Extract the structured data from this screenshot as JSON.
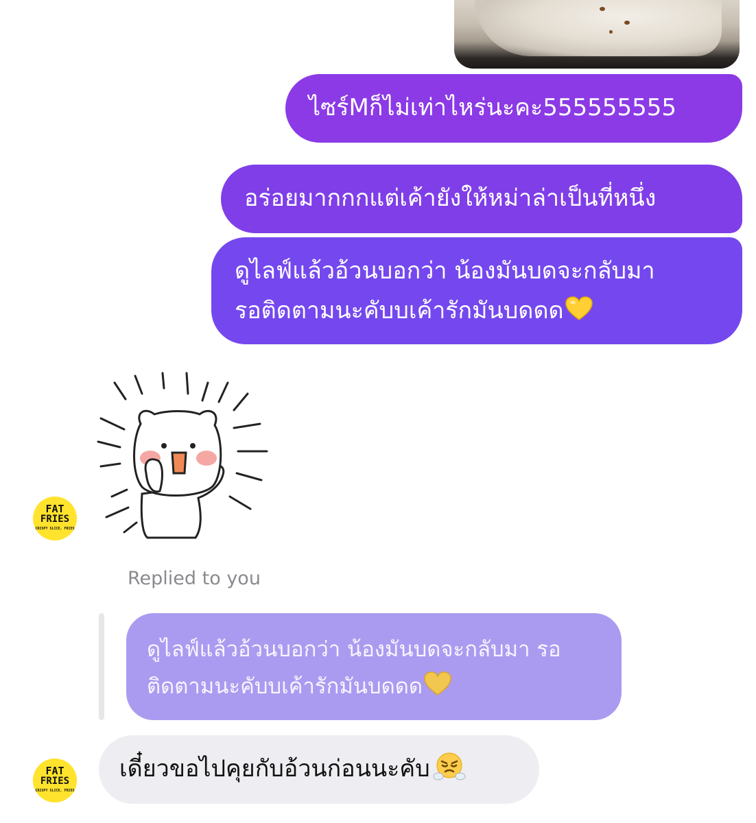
{
  "messages": {
    "outgoing_1": "ไซร์Mก็ไม่เท่าไหร่นะคะ555555555",
    "outgoing_2": "อร่อยมากกกแต่เค้ายังให้หม่าล่าเป็นที่หนึ่ง",
    "outgoing_3_line1": "ดูไลฟ์แล้วอ้วนบอกว่า น้องมันบดจะกลับมา",
    "outgoing_3_line2": "รอติดตามนะคับบเค้ารักมันบดดด",
    "reply_label": "Replied to you",
    "quoted_line1": "ดูไลฟ์แล้วอ้วนบอกว่า น้องมันบดจะกลับมา รอ",
    "quoted_line2": "ติดตามนะคับบเค้ารักมันบดดด",
    "incoming_1": "เดี๋ยวขอไปคุยกับอ้วนก่อนนะคับ"
  },
  "avatar": {
    "logo_line1": "FAT",
    "logo_line2": "FRIES",
    "logo_tagline": "CRISPY SLICE, FRIES"
  },
  "icons": {
    "heart": "yellow-heart-emoji",
    "face": "face-with-steam-emoji",
    "sticker": "excited-bear-sticker"
  },
  "colors": {
    "outgoing_1": "#8b3ae6",
    "outgoing_2": "#7f3ee8",
    "outgoing_3": "#7448ee",
    "quoted": "#ab9bf0",
    "incoming": "#eeeef2",
    "avatar": "#ffe32d"
  }
}
